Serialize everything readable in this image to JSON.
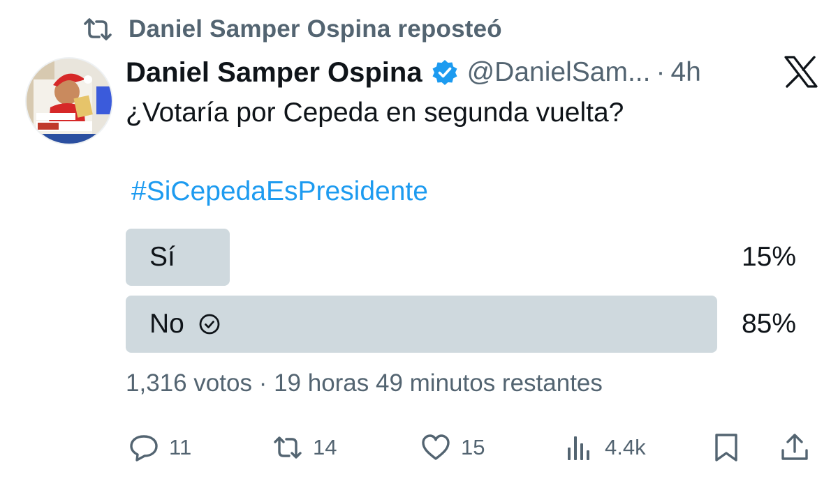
{
  "repost": {
    "text": "Daniel Samper Ospina reposteó",
    "icon": "repost-icon"
  },
  "author": {
    "display_name": "Daniel Samper Ospina",
    "handle": "@DanielSam...",
    "time": "4h",
    "separator": "·",
    "verified_color": "#1d9bf0"
  },
  "tweet": {
    "text": "¿Votaría por Cepeda en segunda vuelta?",
    "hashtag": "#SiCepedaEsPresidente"
  },
  "poll": {
    "options": [
      {
        "label": "Sí",
        "percent_text": "15%",
        "percent": 15,
        "selected": false
      },
      {
        "label": "No",
        "percent_text": "85%",
        "percent": 85,
        "selected": true
      }
    ],
    "meta": "1,316 votos · 19 horas 49 minutos restantes"
  },
  "actions": {
    "replies": "11",
    "reposts": "14",
    "likes": "15",
    "views": "4.4k"
  },
  "colors": {
    "accent": "#1d9bf0",
    "muted": "#536471",
    "bar": "#cfd9de"
  }
}
